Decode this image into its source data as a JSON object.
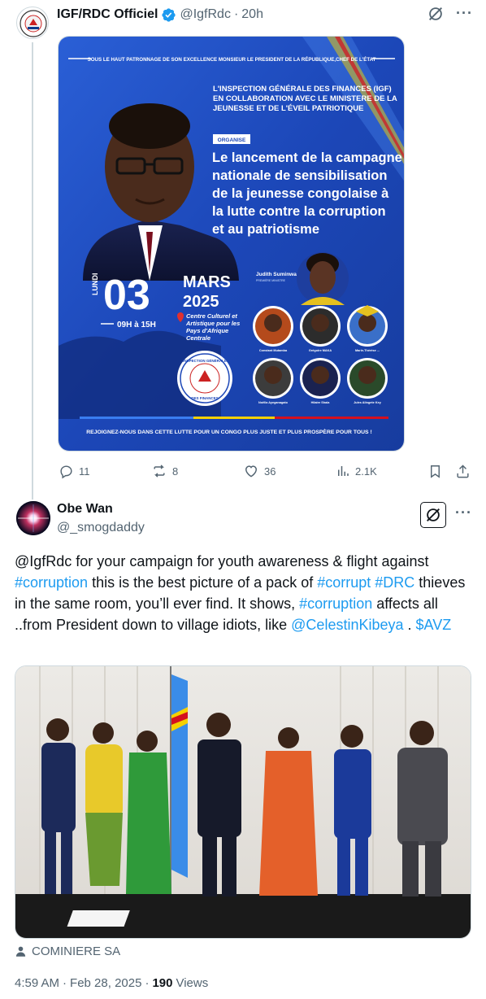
{
  "tweet1": {
    "author_name": "IGF/RDC Officiel",
    "handle": "@IgfRdc",
    "separator": "·",
    "time": "20h",
    "poster": {
      "top_banner": "SOUS LE HAUT PATRONNAGE DE SON EXCELLENCE MONSIEUR LE PRESIDENT DE LA RÉPUBLIQUE,CHEF DE L'ÉTAT",
      "org_line1": "L'INSPECTION GÉNÉRALE DES FINANCES (IGF)",
      "org_line2": "EN COLLABORATION AVEC LE MINISTERE DE LA",
      "org_line3": "JEUNESSE ET DE L'ÉVEIL PATRIOTIQUE",
      "organise_badge": "ORGANISE",
      "headline1": "Le lancement de la campagne",
      "headline2": "nationale de sensibilisation",
      "headline3": "de la jeunesse congolaise à",
      "headline4": "la lutte contre la corruption",
      "headline5": "et au patriotisme",
      "day": "LUNDI",
      "date_num": "03",
      "month": "MARS",
      "year": "2025",
      "hours": "09H à 15H",
      "venue1": "Centre Culturel et",
      "venue2": "Artistique pour les",
      "venue3": "Pays d'Afrique",
      "venue4": "Centrale",
      "pm_name": "Judith Suminwa",
      "pm_title": "PREMIÈRE MINISTRE",
      "speakers": [
        {
          "name": "Constant Mutamba"
        },
        {
          "name": "Grégoire MAKA"
        },
        {
          "name": "Marie-Thérèse ..."
        },
        {
          "name": "Noëlla Ayeganagato"
        },
        {
          "name": "Hilaire Shala"
        },
        {
          "name": "Jules Alingete Key"
        }
      ],
      "seal_top": "INSPECTION GÉNÉRALE",
      "seal_bottom": "DES FINANCES",
      "footer": "REJOIGNEZ-NOUS DANS CETTE LUTTE POUR UN CONGO PLUS JUSTE ET PLUS PROSPÈRE POUR TOUS !"
    },
    "actions": {
      "replies": "11",
      "reposts": "8",
      "likes": "36",
      "views": "2.1K"
    }
  },
  "tweet2": {
    "author_name": "Obe Wan",
    "handle": "@_smogdaddy",
    "text": {
      "p1": "@IgfRdc for your campaign for youth awareness & flight against ",
      "tag1": "#corruption",
      "p2": "  this is the best picture of a pack of ",
      "tag2": "#corrupt",
      "p3": " ",
      "tag3": "#DRC",
      "p4": " thieves in the same room, you’ll ever find. It shows, ",
      "tag4": "#corruption",
      "p5": " affects all ..from President down to village idiots, like ",
      "tag5": "@CelestinKibeya",
      "p6": " . ",
      "tag6": "$AVZ"
    },
    "tagged_user": "COMINIERE SA",
    "time": "4:59 AM",
    "date": "Feb 28, 2025",
    "sep": "·",
    "views_count": "190",
    "views_label": "Views"
  },
  "colors": {
    "accent": "#1d9bf0",
    "muted": "#536471",
    "poster_blue": "#1f4fc7"
  }
}
